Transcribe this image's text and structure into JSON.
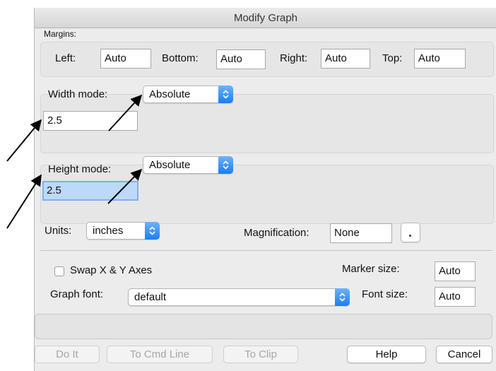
{
  "window": {
    "title": "Modify Graph",
    "background_fragment": "Modify Graph dialog edges"
  },
  "margins": {
    "heading": "Margins:",
    "left_label": "Left:",
    "left_value": "Auto",
    "bottom_label": "Bottom:",
    "bottom_value": "Auto",
    "right_label": "Right:",
    "right_value": "Auto",
    "top_label": "Top:",
    "top_value": "Auto"
  },
  "width": {
    "label": "Width mode:",
    "mode": "Absolute",
    "value": "2.5"
  },
  "height": {
    "label": "Height mode:",
    "mode": "Absolute",
    "value": "2.5"
  },
  "units": {
    "label": "Units:",
    "value": "inches"
  },
  "magnification": {
    "label": "Magnification:",
    "value": "None"
  },
  "options": {
    "swap_label": "Swap X & Y Axes",
    "swap_checked": false,
    "marker_label": "Marker size:",
    "marker_value": "Auto",
    "graph_font_label": "Graph font:",
    "graph_font_value": "default",
    "font_size_label": "Font size:",
    "font_size_value": "Auto"
  },
  "buttons": {
    "do_it": "Do It",
    "to_cmd_line": "To Cmd Line",
    "to_clip": "To Clip",
    "help": "Help",
    "cancel": "Cancel"
  },
  "colors": {
    "accent": "#1b7df4",
    "dialog_bg": "#ececec",
    "focus_bg": "#bcd9f9"
  }
}
